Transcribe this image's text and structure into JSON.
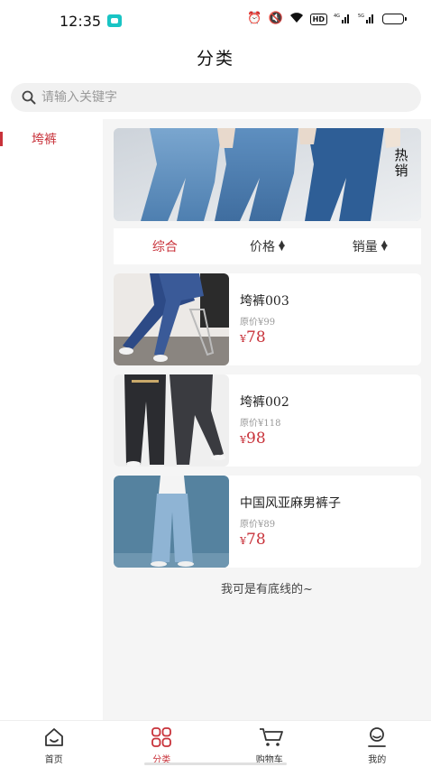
{
  "status_bar": {
    "time": "12:35",
    "network_1": "4G",
    "network_2": "5G"
  },
  "page": {
    "title": "分类"
  },
  "search": {
    "placeholder": "请输入关键字"
  },
  "sidebar": {
    "items": [
      {
        "label": "垮裤",
        "active": true
      }
    ]
  },
  "banner": {
    "tag": "热销"
  },
  "sort_bar": {
    "items": [
      {
        "label": "综合",
        "active": true
      },
      {
        "label": "价格",
        "active": false
      },
      {
        "label": "销量",
        "active": false
      }
    ]
  },
  "products": [
    {
      "name": "垮裤003",
      "original_price": "原价¥99",
      "currency": "¥",
      "price": "78"
    },
    {
      "name": "垮裤002",
      "original_price": "原价¥118",
      "currency": "¥",
      "price": "98"
    },
    {
      "name": "中国风亚麻男裤子",
      "original_price": "原价¥89",
      "currency": "¥",
      "price": "78"
    }
  ],
  "end_note": "我可是有底线的~",
  "tabbar": {
    "items": [
      {
        "label": "首页",
        "icon": "home-icon",
        "active": false
      },
      {
        "label": "分类",
        "icon": "category-grid-icon",
        "active": true
      },
      {
        "label": "购物车",
        "icon": "cart-icon",
        "active": false
      },
      {
        "label": "我的",
        "icon": "profile-icon",
        "active": false
      }
    ]
  },
  "colors": {
    "accent": "#c8323a",
    "background": "#f5f5f5"
  }
}
